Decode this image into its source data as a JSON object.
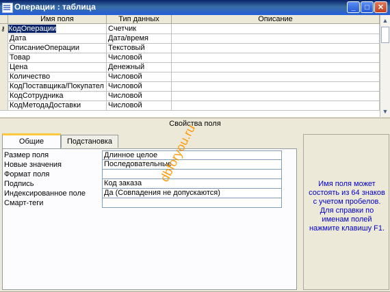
{
  "window": {
    "title": "Операции : таблица",
    "btn_min": "_",
    "btn_max": "□",
    "btn_close": "✕"
  },
  "grid": {
    "columns": [
      "Имя поля",
      "Тип данных",
      "Описание"
    ],
    "rows": [
      {
        "name": "КодОперации",
        "type": "Счетчик",
        "desc": ""
      },
      {
        "name": "Дата",
        "type": "Дата/время",
        "desc": ""
      },
      {
        "name": "ОписаниеОперации",
        "type": "Текстовый",
        "desc": ""
      },
      {
        "name": "Товар",
        "type": "Числовой",
        "desc": ""
      },
      {
        "name": "Цена",
        "type": "Денежный",
        "desc": ""
      },
      {
        "name": "Количество",
        "type": "Числовой",
        "desc": ""
      },
      {
        "name": "КодПоставщика/Покупател",
        "type": "Числовой",
        "desc": ""
      },
      {
        "name": "КодСотрудника",
        "type": "Числовой",
        "desc": ""
      },
      {
        "name": "КодМетодаДоставки",
        "type": "Числовой",
        "desc": ""
      }
    ]
  },
  "properties": {
    "title": "Свойства поля",
    "tabs": [
      "Общие",
      "Подстановка"
    ],
    "items": [
      {
        "label": "Размер поля",
        "value": "Длинное целое"
      },
      {
        "label": "Новые значения",
        "value": "Последовательные"
      },
      {
        "label": "Формат поля",
        "value": ""
      },
      {
        "label": "Подпись",
        "value": "Код заказа"
      },
      {
        "label": "Индексированное поле",
        "value": "Да (Совпадения не допускаются)"
      },
      {
        "label": "Смарт-теги",
        "value": ""
      }
    ],
    "help": "Имя поля может состоять из 64 знаков с учетом пробелов.  Для справки по именам полей нажмите клавишу F1."
  },
  "watermark": "dbforyou.ru",
  "colors": {
    "titlebar": "#0a246a",
    "selection": "#0a246a",
    "help_text": "#0000cc",
    "watermark": "#ff9900",
    "active_tab_accent": "#ffc83d"
  }
}
